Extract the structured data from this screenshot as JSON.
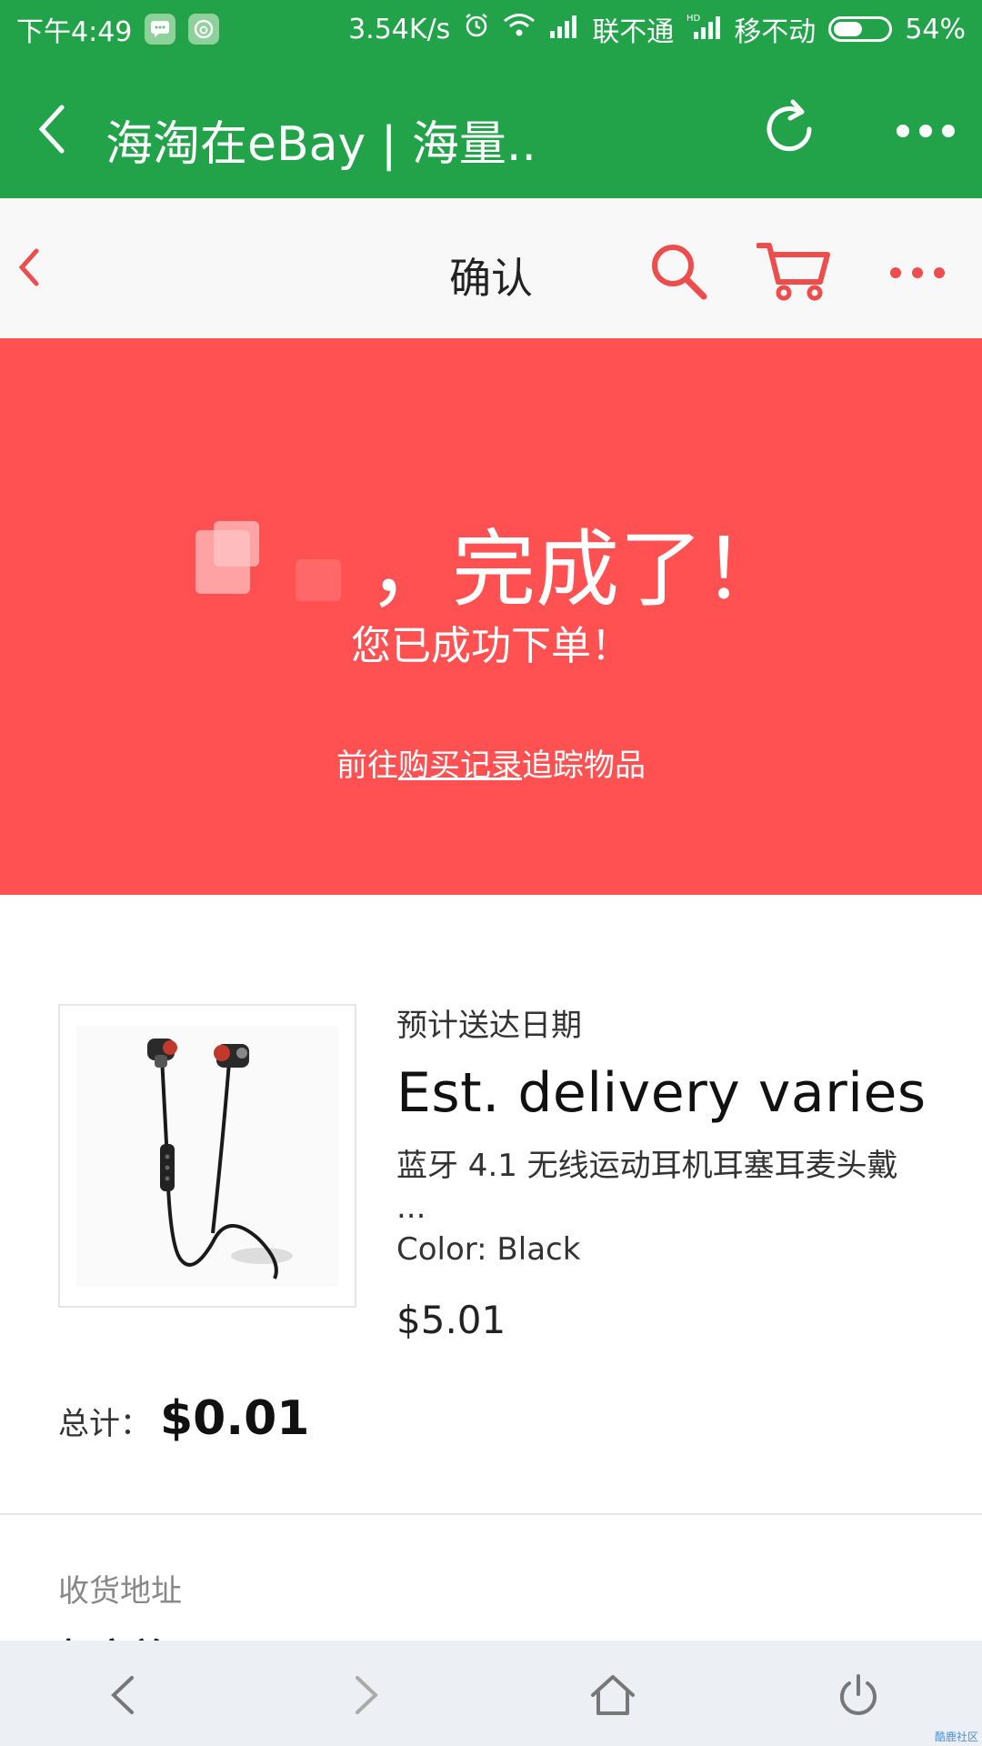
{
  "statusbar": {
    "time": "下午4:49",
    "speed": "3.54K/s",
    "carrier1": "联不通",
    "carrier2": "移不动",
    "battery_pct": "54%",
    "battery_level": 0.54
  },
  "titlebar": {
    "title": "海淘在eBay | 海量.."
  },
  "navbar": {
    "title": "确认",
    "accent": "#ee4d4d"
  },
  "hero": {
    "headline": "，完成了！",
    "message": "您已成功下单！",
    "goto_prefix": "前往",
    "goto_link": "购买记录",
    "goto_suffix": "追踪物品",
    "background": "#ff5052"
  },
  "item": {
    "est_label": "预计送达日期",
    "est_value": "Est. delivery varies",
    "title": "蓝牙 4.1 无线运动耳机耳塞耳麦头戴",
    "title_more": "...",
    "variant": "Color: Black",
    "price": "$5.01"
  },
  "total": {
    "label": "总计：",
    "value": "$0.01"
  },
  "address": {
    "label": "收货地址",
    "name_partial": "赵文慈"
  },
  "bottombar": {
    "watermark": "酷鹿社区"
  }
}
